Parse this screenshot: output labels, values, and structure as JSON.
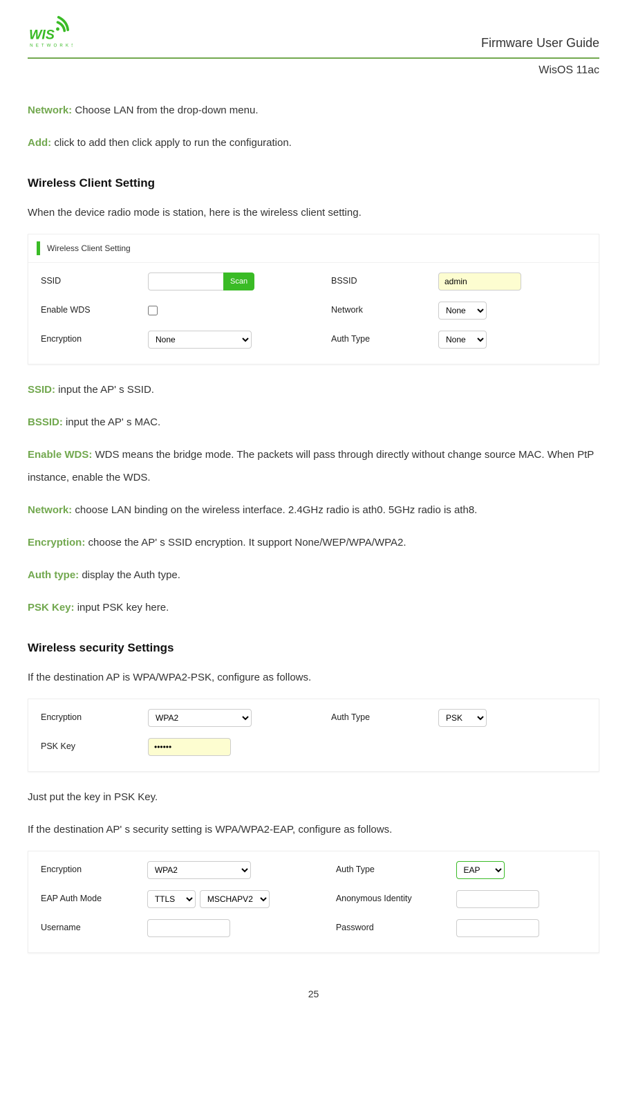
{
  "header": {
    "guide": "Firmware User Guide",
    "os": "WisOS 11ac"
  },
  "intro": {
    "network_label": "Network:",
    "network_text": " Choose LAN from the drop-down menu.",
    "add_label": "Add:",
    "add_text": " click to add then click apply to run the configuration."
  },
  "section1": {
    "title": "Wireless Client Setting",
    "desc": "When the device radio mode is station, here is the wireless client setting.",
    "panel_title": "Wireless Client Setting",
    "ssid_label": "SSID",
    "ssid_value": "",
    "scan": "Scan",
    "bssid_label": "BSSID",
    "bssid_value": "admin",
    "wds_label": "Enable WDS",
    "network_label": "Network",
    "network_value": "None",
    "enc_label": "Encryption",
    "enc_value": "None",
    "auth_label": "Auth Type",
    "auth_value": "None",
    "defs": {
      "ssid_l": "SSID:",
      "ssid_t": " input the AP' s SSID.",
      "bssid_l": "BSSID:",
      "bssid_t": " input the AP' s MAC.",
      "wds_l": "Enable WDS:",
      "wds_t": " WDS means the bridge mode. The packets will pass through directly without change source MAC. When PtP instance, enable the WDS.",
      "net_l": "Network:",
      "net_t": " choose LAN binding on the wireless interface. 2.4GHz radio is ath0. 5GHz radio is ath8.",
      "enc_l": "Encryption:",
      "enc_t": " choose the AP' s SSID encryption. It support None/WEP/WPA/WPA2.",
      "auth_l": "Auth type:",
      "auth_t": " display the Auth type.",
      "psk_l": "PSK Key:",
      "psk_t": " input PSK key here."
    }
  },
  "section2": {
    "title": "Wireless security Settings",
    "desc1": "If the destination AP is WPA/WPA2-PSK, configure as follows.",
    "panel1": {
      "enc_label": "Encryption",
      "enc_value": "WPA2",
      "auth_label": "Auth Type",
      "auth_value": "PSK",
      "psk_label": "PSK Key",
      "psk_value": "••••••"
    },
    "line1": "Just put the key in PSK Key.",
    "desc2": "If the destination AP' s security setting is WPA/WPA2-EAP, configure as follows.",
    "panel2": {
      "enc_label": "Encryption",
      "enc_value": "WPA2",
      "auth_label": "Auth Type",
      "auth_value": "EAP",
      "eap_label": "EAP Auth Mode",
      "eap_v1": "TTLS",
      "eap_v2": "MSCHAPV2",
      "anon_label": "Anonymous Identity",
      "anon_value": "",
      "user_label": "Username",
      "user_value": "",
      "pass_label": "Password",
      "pass_value": ""
    }
  },
  "page": "25"
}
